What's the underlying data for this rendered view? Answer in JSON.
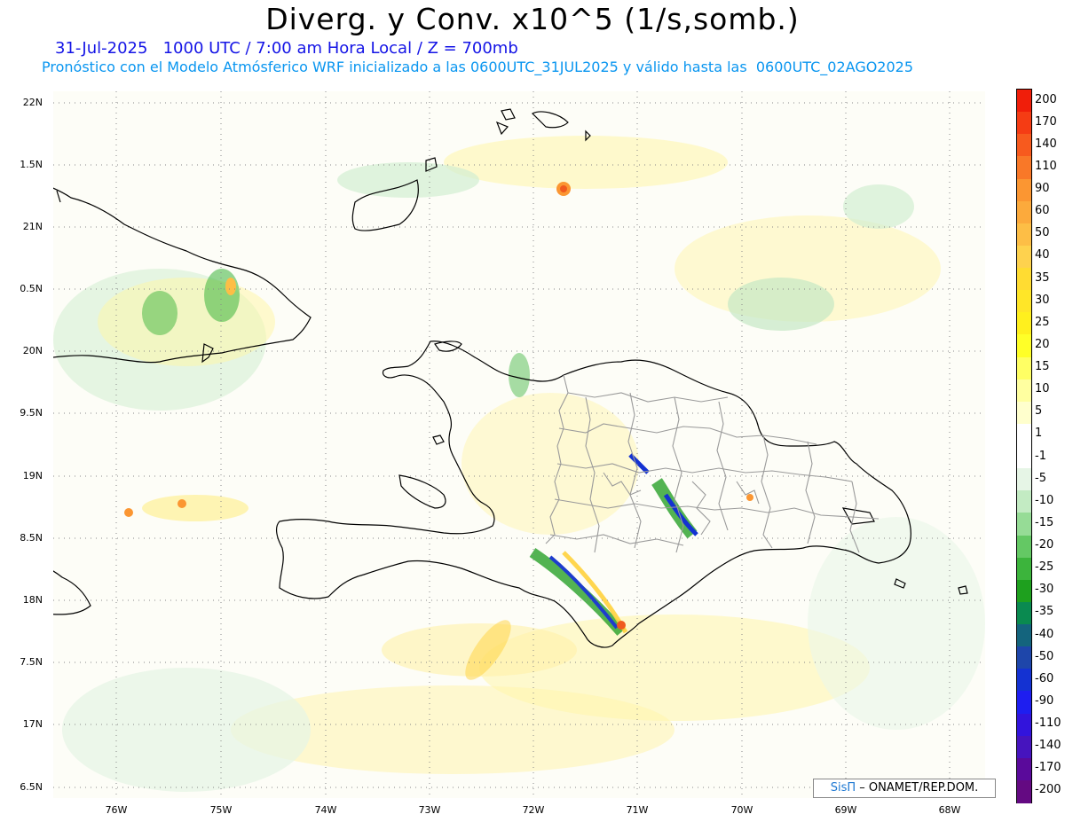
{
  "title": "Diverg. y Conv. x10^5 (1/s,somb.)",
  "subtitle_date": "31-Jul-2025   1000 UTC / 7:00 am Hora Local / Z = 700mb",
  "subtitle_model": "Pronóstico con el Modelo Atmósferico WRF inicializado a las 0600UTC_31JUL2025 y válido hasta las  0600UTC_02AGO2025",
  "lat_labels": [
    "22N",
    "1.5N",
    "21N",
    "0.5N",
    "20N",
    "9.5N",
    "19N",
    "8.5N",
    "18N",
    "7.5N",
    "17N",
    "6.5N"
  ],
  "lon_labels": [
    "76W",
    "75W",
    "74W",
    "73W",
    "72W",
    "71W",
    "70W",
    "69W",
    "68W"
  ],
  "colorbar": {
    "labels": [
      "200",
      "170",
      "140",
      "110",
      "90",
      "60",
      "50",
      "40",
      "35",
      "30",
      "25",
      "20",
      "15",
      "10",
      "5",
      "1",
      "-1",
      "-5",
      "-10",
      "-15",
      "-20",
      "-25",
      "-30",
      "-35",
      "-40",
      "-50",
      "-60",
      "-90",
      "-110",
      "-140",
      "-170",
      "-200"
    ],
    "colors": [
      "#f01e0a",
      "#f53c14",
      "#f75a1e",
      "#f97828",
      "#fb9632",
      "#fcaa3c",
      "#fdbe46",
      "#fed24e",
      "#ffdc32",
      "#ffe628",
      "#fff01e",
      "#ffff28",
      "#ffff64",
      "#ffffa0",
      "#ffffcd",
      "#ffffff",
      "#ffffff",
      "#e6f5e6",
      "#c3ebc3",
      "#96dc96",
      "#64c864",
      "#3cb43c",
      "#1ea01e",
      "#0a8a50",
      "#14647d",
      "#1e46aa",
      "#1432d2",
      "#1e1ef0",
      "#3214dc",
      "#4614be",
      "#5a0a9b",
      "#640a82"
    ]
  },
  "credit": {
    "logo": "SisΠ",
    "text": " – ONAMET/REP.DOM."
  },
  "colors": {
    "coast": "#000000",
    "provinces": "#9a9a9a",
    "ocean_fill": "#fdfdf7"
  }
}
